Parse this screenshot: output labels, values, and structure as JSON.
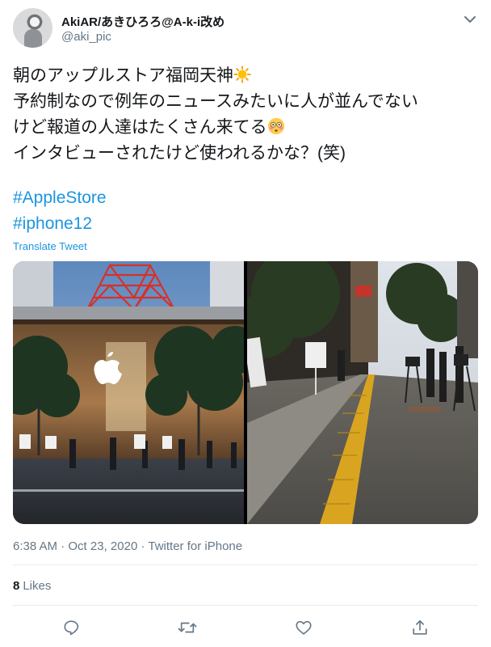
{
  "author": {
    "display_name": "AkiAR/あきひろろ@A-k-i改め",
    "handle": "@aki_pic"
  },
  "tweet": {
    "lines": [
      "朝のアップルストア福岡天神",
      "予約制なので例年のニュースみたいに人が並んでない",
      "けど報道の人達はたくさん来てる",
      "インタビューされたけど使われるかな？(笑)"
    ],
    "hashtags": [
      "#AppleStore",
      "#iphone12"
    ],
    "translate_label": "Translate Tweet"
  },
  "photos": [
    {
      "icon": "apple-store-photo"
    },
    {
      "icon": "street-sidewalk-photo"
    }
  ],
  "meta": {
    "time": "6:38 AM",
    "separator": "·",
    "date": "Oct 23, 2020",
    "source": "Twitter for iPhone"
  },
  "stats": {
    "likes_count": "8",
    "likes_label": "Likes"
  },
  "actions": [
    "reply-icon",
    "retweet-icon",
    "like-icon",
    "share-icon"
  ],
  "colors": {
    "link": "#1b95e0",
    "secondary_text": "#657786",
    "divider": "#e6ecf0"
  }
}
